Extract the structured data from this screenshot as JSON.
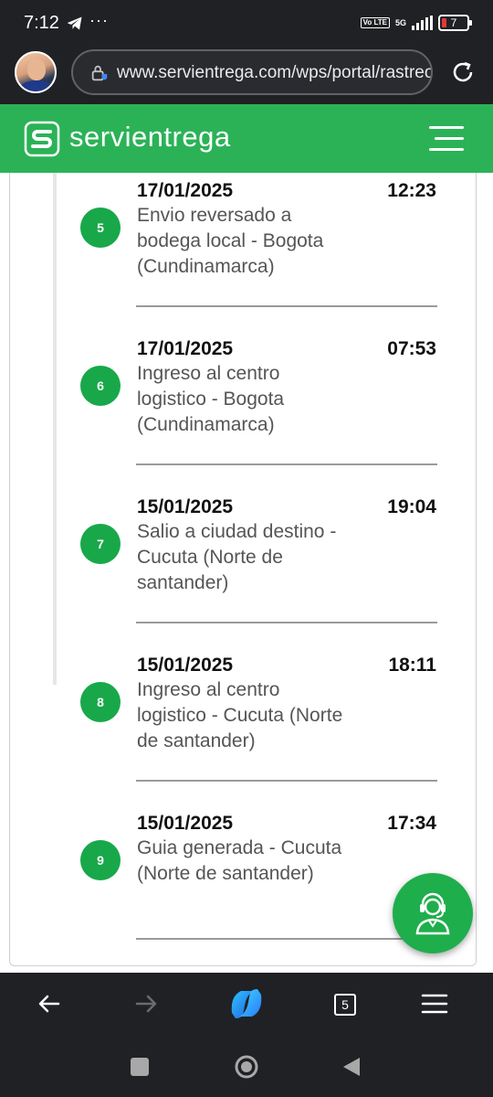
{
  "status_bar": {
    "time": "7:12",
    "dots": "···",
    "volte": "Vo LTE",
    "network": "5G",
    "battery": "7"
  },
  "browser": {
    "url": "www.servientrega.com/wps/portal/rastreo",
    "tab_count": "5"
  },
  "header": {
    "brand": "servientrega"
  },
  "colors": {
    "brand_green": "#2bb257",
    "badge_green": "#18a84a"
  },
  "events": [
    {
      "number": "5",
      "date": "17/01/2025",
      "time": "12:23",
      "description": "Envio reversado a bodega local - Bogota (Cundinamarca)"
    },
    {
      "number": "6",
      "date": "17/01/2025",
      "time": "07:53",
      "description": "Ingreso al centro logistico - Bogota (Cundinamarca)"
    },
    {
      "number": "7",
      "date": "15/01/2025",
      "time": "19:04",
      "description": "Salio a ciudad destino - Cucuta (Norte de santander)"
    },
    {
      "number": "8",
      "date": "15/01/2025",
      "time": "18:11",
      "description": "Ingreso al centro logistico - Cucuta (Norte de santander)"
    },
    {
      "number": "9",
      "date": "15/01/2025",
      "time": "17:34",
      "description": "Guia generada - Cucuta (Norte de santander)"
    }
  ],
  "icons": {
    "status": [
      "telegram-icon",
      "signal-icon",
      "battery-icon"
    ],
    "browser": [
      "avatar",
      "site-info-icon",
      "reload-icon"
    ],
    "header": [
      "servientrega-logo-icon",
      "hamburger-menu-icon"
    ],
    "floating": "support-agent-icon",
    "browser_nav": [
      "back-arrow-icon",
      "forward-arrow-icon",
      "copilot-icon",
      "tabs-icon",
      "menu-icon"
    ],
    "system_nav": [
      "recents-square-icon",
      "home-circle-icon",
      "back-triangle-icon"
    ]
  }
}
